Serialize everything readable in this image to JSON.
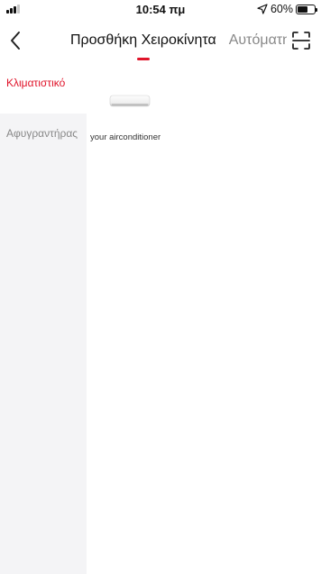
{
  "status_bar": {
    "time": "10:54 πμ",
    "battery_percent": "60%",
    "battery_level": 0.6,
    "signal_bars_on": 3,
    "icons": [
      "signal-icon",
      "location-arrow-icon",
      "battery-icon"
    ]
  },
  "nav": {
    "back_icon": "chevron-left-icon",
    "tabs": [
      {
        "label": "Προσθήκη Χειροκίνητα",
        "active": true
      },
      {
        "label": "Αυτόματη",
        "active": false
      }
    ],
    "scan_icon": "scan-icon"
  },
  "sidebar": {
    "items": [
      {
        "label": "Κλιματιστικό",
        "active": true
      },
      {
        "label": "Αφυγραντήρας",
        "active": false
      }
    ]
  },
  "content": {
    "devices": [
      {
        "label": "your airconditioner",
        "icon": "air-conditioner-icon"
      }
    ]
  },
  "colors": {
    "accent": "#e0142a",
    "sidebar_bg": "#f4f4f6",
    "inactive_text": "#888888"
  }
}
